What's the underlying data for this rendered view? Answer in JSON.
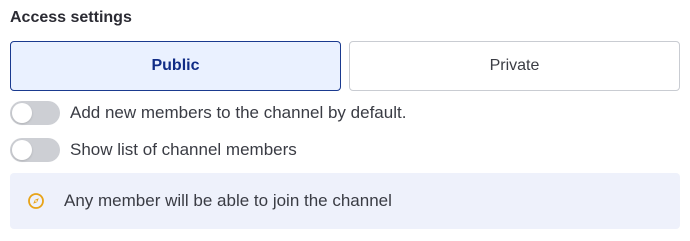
{
  "section": {
    "title": "Access settings"
  },
  "access_toggle": {
    "options": [
      {
        "label": "Public",
        "selected": true
      },
      {
        "label": "Private",
        "selected": false
      }
    ]
  },
  "switches": [
    {
      "label": "Add new members to the channel by default.",
      "on": false
    },
    {
      "label": "Show list of channel members",
      "on": false
    }
  ],
  "info": {
    "icon": "compass-icon",
    "text": "Any member will be able to join the channel"
  },
  "colors": {
    "accent": "#1a3a8f",
    "selected_bg": "#eaf1ff",
    "info_bg": "#eef1fb",
    "icon_color": "#e8a317",
    "switch_off": "#cdcfd4"
  }
}
